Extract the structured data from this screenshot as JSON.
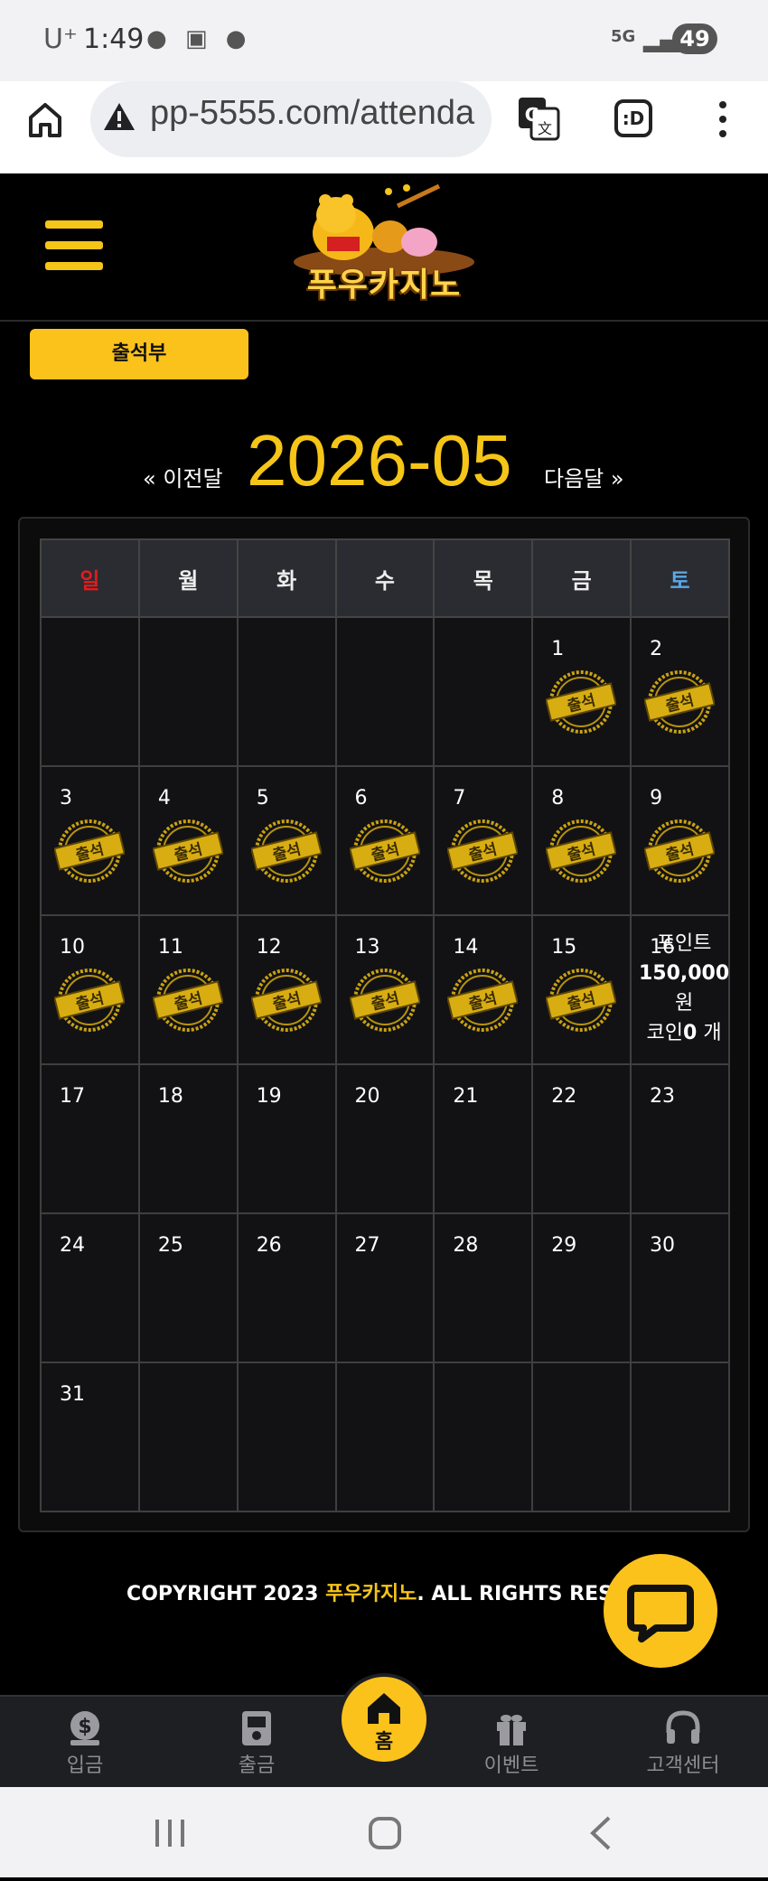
{
  "status_bar": {
    "carrier": "U⁺",
    "time": "1:49",
    "network": "5G",
    "battery": "49"
  },
  "browser": {
    "url": "pp-5555.com/attenda",
    "tab_icon_label": ":D"
  },
  "site": {
    "logo_text": "푸우카지노",
    "page_tab_label": "출석부"
  },
  "month_nav": {
    "prev_label": "« 이전달",
    "title": "2026-05",
    "next_label": "다음달 »"
  },
  "calendar": {
    "weekdays": [
      "일",
      "월",
      "화",
      "수",
      "목",
      "금",
      "토"
    ],
    "stamp_label": "출석",
    "weeks": [
      [
        "",
        "",
        "",
        "",
        "",
        "1",
        "2"
      ],
      [
        "3",
        "4",
        "5",
        "6",
        "7",
        "8",
        "9"
      ],
      [
        "10",
        "11",
        "12",
        "13",
        "14",
        "15",
        "16"
      ],
      [
        "17",
        "18",
        "19",
        "20",
        "21",
        "22",
        "23"
      ],
      [
        "24",
        "25",
        "26",
        "27",
        "28",
        "29",
        "30"
      ],
      [
        "31",
        "",
        "",
        "",
        "",
        "",
        ""
      ]
    ],
    "attended_days": [
      1,
      2,
      3,
      4,
      5,
      6,
      7,
      8,
      9,
      10,
      11,
      12,
      13,
      14,
      15
    ],
    "today_reward": {
      "point_label": "포인트",
      "point_value": "150,000",
      "point_unit": "원",
      "coin_label": "코인",
      "coin_value": "0",
      "coin_unit": "개"
    }
  },
  "footer": {
    "copyright_prefix": "COPYRIGHT 2023 ",
    "brand": "푸우카지노",
    "copyright_suffix": ". ALL RIGHTS RESER"
  },
  "bottom_nav": {
    "deposit": "입금",
    "withdraw": "출금",
    "home": "홈",
    "event": "이벤트",
    "support": "고객센터"
  },
  "colors": {
    "accent": "#fbc21c",
    "sunday": "#e01c1c",
    "saturday": "#5aa8e6",
    "background": "#000000"
  }
}
